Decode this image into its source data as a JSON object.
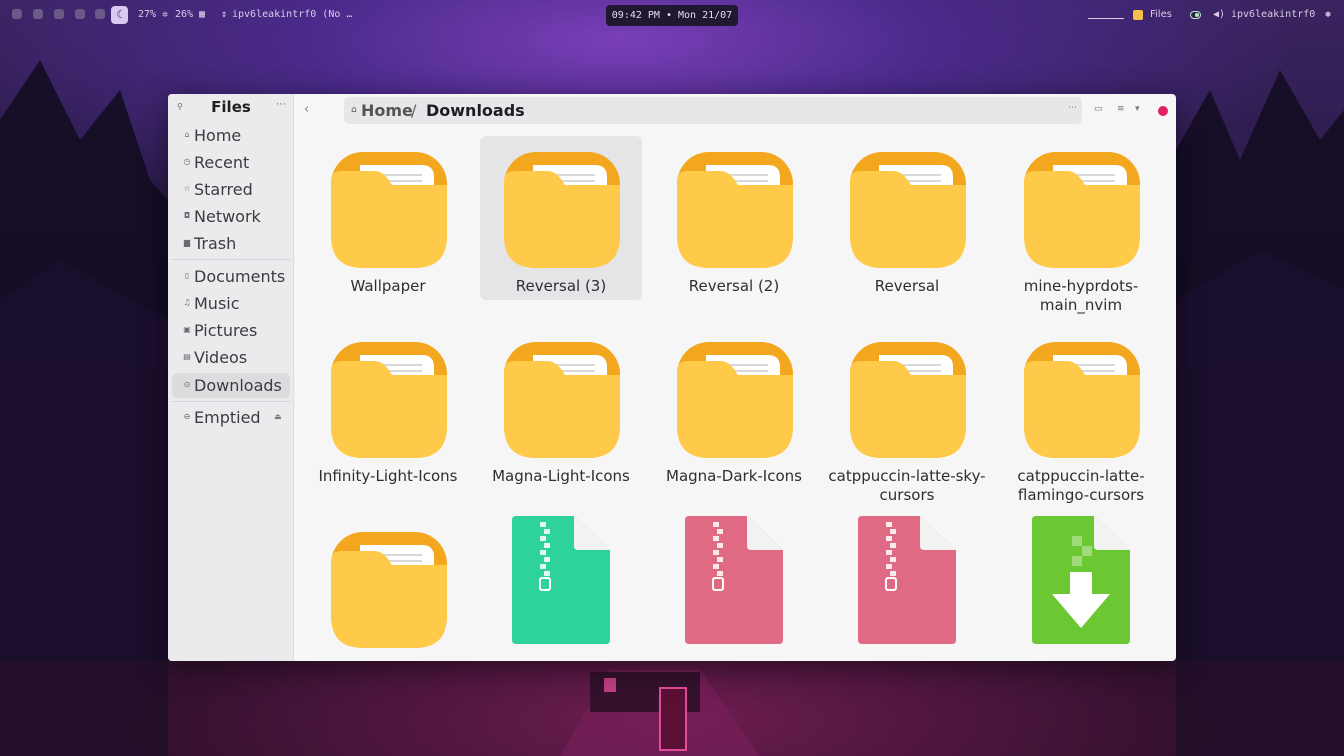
{
  "topbar": {
    "battery": "27%",
    "cpu": "26%",
    "network": "ipv6leakintrf0 (No …",
    "clock": "09:42 PM • Mon 21/07",
    "active_app": "Files",
    "volume_device": "ipv6leakintrf0"
  },
  "sidebar": {
    "title": "Files",
    "places": [
      {
        "label": "Home",
        "icon": "home-icon"
      },
      {
        "label": "Recent",
        "icon": "clock-icon"
      },
      {
        "label": "Starred",
        "icon": "star-icon"
      },
      {
        "label": "Network",
        "icon": "network-icon"
      },
      {
        "label": "Trash",
        "icon": "trash-icon"
      }
    ],
    "bookmarks": [
      {
        "label": "Documents",
        "icon": "document-icon"
      },
      {
        "label": "Music",
        "icon": "music-icon"
      },
      {
        "label": "Pictures",
        "icon": "picture-icon"
      },
      {
        "label": "Videos",
        "icon": "video-icon"
      },
      {
        "label": "Downloads",
        "icon": "download-icon",
        "active": true
      }
    ],
    "devices": [
      {
        "label": "Emptied",
        "icon": "drive-icon"
      }
    ]
  },
  "path": {
    "home": "Home",
    "separator": "/",
    "current": "Downloads"
  },
  "items": [
    {
      "name": "Wallpaper",
      "type": "folder"
    },
    {
      "name": "Reversal (3)",
      "type": "folder",
      "selected": true
    },
    {
      "name": "Reversal (2)",
      "type": "folder"
    },
    {
      "name": "Reversal",
      "type": "folder"
    },
    {
      "name": "mine-hyprdots-main_nvim",
      "type": "folder"
    },
    {
      "name": "Infinity-Light-Icons",
      "type": "folder"
    },
    {
      "name": "Magna-Light-Icons",
      "type": "folder"
    },
    {
      "name": "Magna-Dark-Icons",
      "type": "folder"
    },
    {
      "name": "catppuccin-latte-sky-cursors",
      "type": "folder"
    },
    {
      "name": "catppuccin-latte-flamingo-cursors",
      "type": "folder"
    },
    {
      "name": "",
      "type": "folder"
    },
    {
      "name": "",
      "type": "archive",
      "color": "#2ed39a"
    },
    {
      "name": "",
      "type": "archive",
      "color": "#e06a83"
    },
    {
      "name": "",
      "type": "archive",
      "color": "#e06a83"
    },
    {
      "name": "",
      "type": "download",
      "color": "#6cc832"
    }
  ],
  "colors": {
    "folder_body": "#ffc94a",
    "folder_tab": "#f3a71e",
    "close_button": "#e0245e"
  }
}
